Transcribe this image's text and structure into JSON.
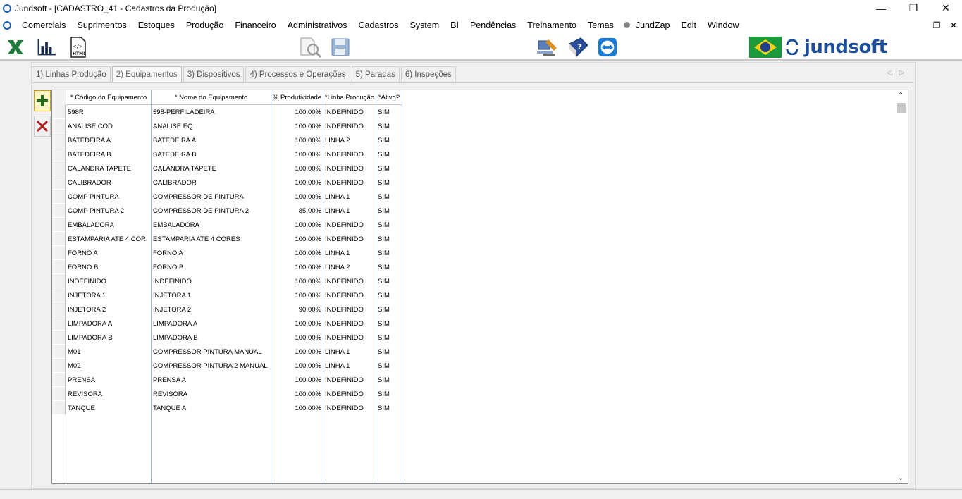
{
  "window": {
    "title": "Jundsoft - [CADASTRO_41 - Cadastros da Produção]"
  },
  "menu": [
    "Comerciais",
    "Suprimentos",
    "Estoques",
    "Produção",
    "Financeiro",
    "Administrativos",
    "Cadastros",
    "System",
    "BI",
    "Pendências",
    "Treinamento",
    "Temas",
    "JundZap",
    "Edit",
    "Window"
  ],
  "toolbar": {
    "html_label": "HTML"
  },
  "logo": {
    "text": "jundsoft"
  },
  "tabs": [
    "1) Linhas Produção",
    "2) Equipamentos",
    "3) Dispositivos",
    "4) Processos e Operações",
    "5) Paradas",
    "6) Inspeções"
  ],
  "active_tab": 1,
  "grid": {
    "columns": [
      "* Código do Equipamento",
      "* Nome do Equipamento",
      "% Produtividade",
      "*Linha Produção",
      "*Ativo?"
    ],
    "rows": [
      [
        "598R",
        "598-PERFILADEIRA",
        "100,00%",
        "INDEFINIDO",
        "SIM"
      ],
      [
        "ANALISE COD",
        "ANALISE EQ",
        "100,00%",
        "INDEFINIDO",
        "SIM"
      ],
      [
        "BATEDEIRA A",
        "BATEDEIRA A",
        "100,00%",
        "LINHA 2",
        "SIM"
      ],
      [
        "BATEDEIRA B",
        "BATEDEIRA B",
        "100,00%",
        "INDEFINIDO",
        "SIM"
      ],
      [
        "CALANDRA TAPETE",
        "CALANDRA TAPETE",
        "100,00%",
        "INDEFINIDO",
        "SIM"
      ],
      [
        "CALIBRADOR",
        "CALIBRADOR",
        "100,00%",
        "INDEFINIDO",
        "SIM"
      ],
      [
        "COMP PINTURA",
        "COMPRESSOR DE PINTURA",
        "100,00%",
        "LINHA 1",
        "SIM"
      ],
      [
        "COMP PINTURA 2",
        "COMPRESSOR DE PINTURA 2",
        "85,00%",
        "LINHA 1",
        "SIM"
      ],
      [
        "EMBALADORA",
        "EMBALADORA",
        "100,00%",
        "INDEFINIDO",
        "SIM"
      ],
      [
        "ESTAMPARIA ATE 4 COR",
        "ESTAMPARIA ATE 4 CORES",
        "100,00%",
        "INDEFINIDO",
        "SIM"
      ],
      [
        "FORNO A",
        "FORNO A",
        "100,00%",
        "LINHA 1",
        "SIM"
      ],
      [
        "FORNO B",
        "FORNO B",
        "100,00%",
        "LINHA 2",
        "SIM"
      ],
      [
        "INDEFINIDO",
        "INDEFINIDO",
        "100,00%",
        "INDEFINIDO",
        "SIM"
      ],
      [
        "INJETORA 1",
        "INJETORA 1",
        "100,00%",
        "INDEFINIDO",
        "SIM"
      ],
      [
        "INJETORA 2",
        "INJETORA 2",
        "90,00%",
        "INDEFINIDO",
        "SIM"
      ],
      [
        "LIMPADORA A",
        "LIMPADORA A",
        "100,00%",
        "INDEFINIDO",
        "SIM"
      ],
      [
        "LIMPADORA B",
        "LIMPADORA B",
        "100,00%",
        "INDEFINIDO",
        "SIM"
      ],
      [
        "M01",
        "COMPRESSOR PINTURA MANUAL",
        "100,00%",
        "LINHA 1",
        "SIM"
      ],
      [
        "M02",
        "COMPRESSOR PINTURA 2 MANUAL",
        "100,00%",
        "LINHA 1",
        "SIM"
      ],
      [
        "PRENSA",
        "PRENSA A",
        "100,00%",
        "INDEFINIDO",
        "SIM"
      ],
      [
        "REVISORA",
        "REVISORA",
        "100,00%",
        "INDEFINIDO",
        "SIM"
      ],
      [
        "TANQUE",
        "TANQUE A",
        "100,00%",
        "INDEFINIDO",
        "SIM"
      ]
    ]
  },
  "icons": {
    "excel": "excel-icon",
    "chart": "chart-icon",
    "html": "html-icon",
    "search_doc": "search-document-icon",
    "save": "save-icon",
    "remote": "remote-support-icon",
    "help": "help-book-icon",
    "teamviewer": "teamviewer-icon",
    "add": "add-icon",
    "delete": "delete-icon"
  },
  "colors": {
    "accent": "#1a4c9a",
    "excel_green": "#1d7a3a",
    "delete_red": "#b02020"
  }
}
